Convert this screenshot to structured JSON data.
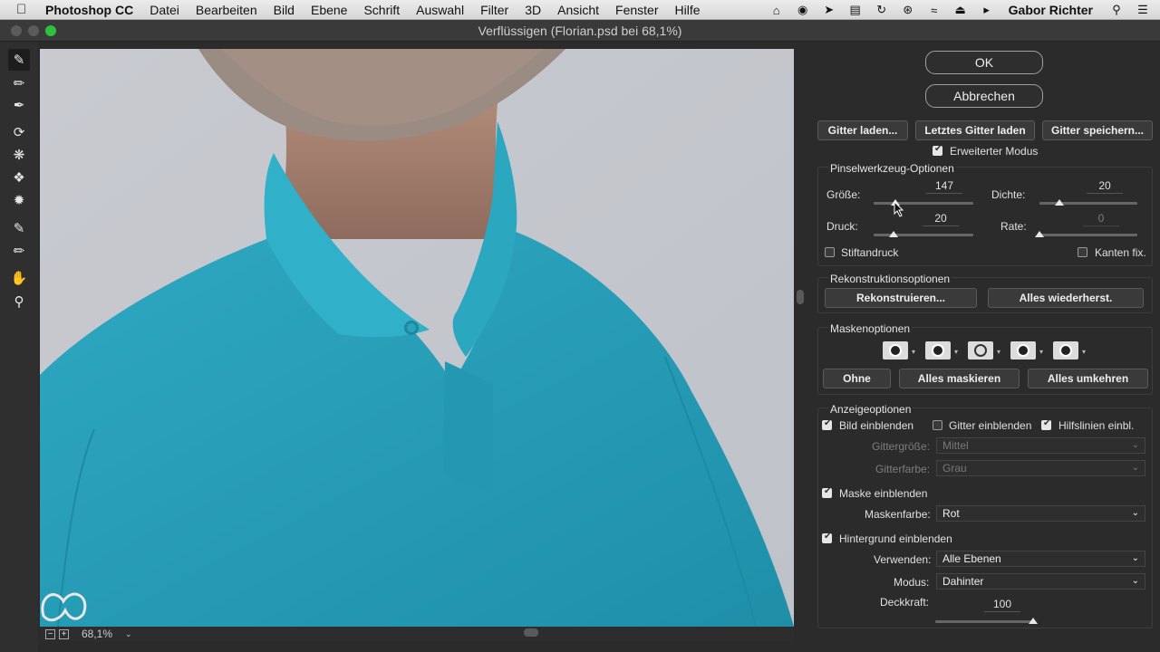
{
  "menubar": {
    "app": "Photoshop CC",
    "items": [
      "Datei",
      "Bearbeiten",
      "Bild",
      "Ebene",
      "Schrift",
      "Auswahl",
      "Filter",
      "3D",
      "Ansicht",
      "Fenster",
      "Hilfe"
    ],
    "user": "Gabor Richter"
  },
  "window": {
    "title": "Verflüssigen (Florian.psd bei 68,1%)"
  },
  "status": {
    "zoom": "68,1%"
  },
  "panel": {
    "ok": "OK",
    "cancel": "Abbrechen",
    "load_mesh": "Gitter laden...",
    "load_last_mesh": "Letztes Gitter laden",
    "save_mesh": "Gitter speichern...",
    "advanced_mode": "Erweiterter Modus",
    "brush_options": {
      "title": "Pinselwerkzeug-Optionen",
      "size_label": "Größe:",
      "size": "147",
      "size_pos": 0.22,
      "density_label": "Dichte:",
      "density": "20",
      "density_pos": 0.2,
      "pressure_label": "Druck:",
      "pressure": "20",
      "pressure_pos": 0.2,
      "rate_label": "Rate:",
      "rate": "0",
      "rate_pos": 0.0,
      "stylus": "Stiftandruck",
      "pin_edges": "Kanten fix."
    },
    "reconstruct": {
      "title": "Rekonstruktionsoptionen",
      "reconstruct": "Rekonstruieren...",
      "restore_all": "Alles wiederherst."
    },
    "mask": {
      "title": "Maskenoptionen",
      "none": "Ohne",
      "mask_all": "Alles maskieren",
      "invert_all": "Alles umkehren"
    },
    "view": {
      "title": "Anzeigeoptionen",
      "show_image": "Bild einblenden",
      "show_mesh": "Gitter einblenden",
      "show_guides": "Hilfslinien einbl.",
      "mesh_size_label": "Gittergröße:",
      "mesh_size": "Mittel",
      "mesh_color_label": "Gitterfarbe:",
      "mesh_color": "Grau",
      "show_mask": "Maske einblenden",
      "mask_color_label": "Maskenfarbe:",
      "mask_color": "Rot",
      "show_backdrop": "Hintergrund einblenden",
      "use_label": "Verwenden:",
      "use": "Alle Ebenen",
      "mode_label": "Modus:",
      "mode": "Dahinter",
      "opacity_label": "Deckkraft:",
      "opacity": "100",
      "opacity_pos": 1.0
    }
  },
  "colors": {
    "shirt": "#2aa3bd",
    "backdrop": "#c9cbd1"
  }
}
